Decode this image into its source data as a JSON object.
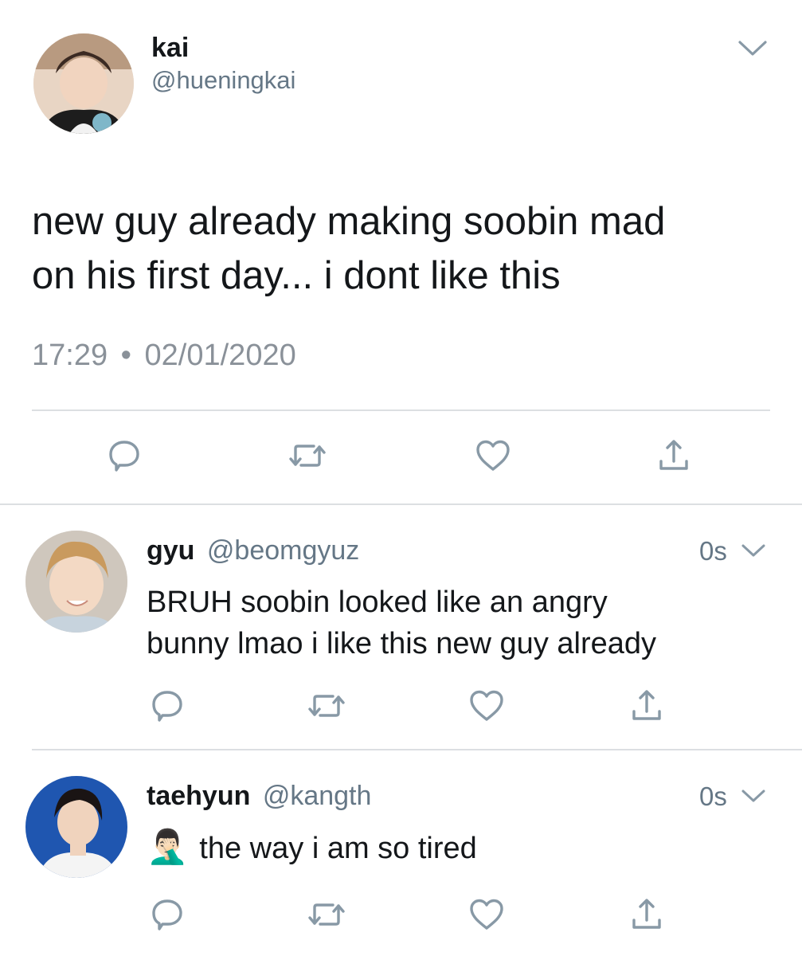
{
  "main_tweet": {
    "name": "kai",
    "handle": "@hueningkai",
    "text_line1": "new guy already making soobin mad",
    "text_line2": "on his first day... i dont like this",
    "time": "17:29",
    "separator": "•",
    "date": "02/01/2020"
  },
  "replies": [
    {
      "name": "gyu",
      "handle": "@beomgyuz",
      "time": "0s",
      "text_line1": "BRUH soobin looked like an angry",
      "text_line2": "bunny lmao i like this new guy already"
    },
    {
      "name": "taehyun",
      "handle": "@kangth",
      "time": "0s",
      "emoji": "🤦🏻‍♂️",
      "text_line1": "the way i am so tired"
    }
  ],
  "icons": {
    "reply": "reply-icon",
    "retweet": "retweet-icon",
    "like": "heart-icon",
    "share": "share-icon",
    "more": "chevron-down-icon"
  },
  "colors": {
    "icon_gray": "#8899a6",
    "text_dark": "#14171a",
    "text_muted": "#657786",
    "divider": "#dcdfe2"
  }
}
